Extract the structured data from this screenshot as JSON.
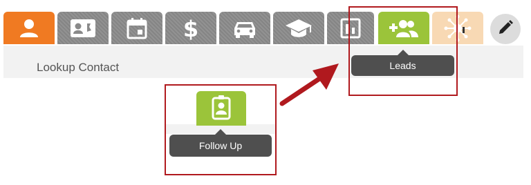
{
  "toolbar": {
    "tabs": [
      {
        "name": "contacts",
        "icon": "person-icon",
        "color": "#f07a22"
      },
      {
        "name": "contact-card",
        "icon": "contact-card-icon",
        "color": "#8a8a8a"
      },
      {
        "name": "calendar",
        "icon": "calendar-icon",
        "color": "#8a8a8a"
      },
      {
        "name": "finance",
        "icon": "dollar-icon",
        "color": "#8a8a8a"
      },
      {
        "name": "vehicles",
        "icon": "car-icon",
        "color": "#8a8a8a"
      },
      {
        "name": "education",
        "icon": "graduation-cap-icon",
        "color": "#8a8a8a"
      },
      {
        "name": "reports",
        "icon": "bar-chart-icon",
        "color": "#8a8a8a"
      },
      {
        "name": "leads",
        "icon": "add-people-icon",
        "color": "#9bc43a"
      },
      {
        "name": "network",
        "icon": "network-burst-icon",
        "color": "#f8d9b4"
      }
    ],
    "edit_icon": "pencil-icon"
  },
  "subbar": {
    "label": "Lookup Contact"
  },
  "tooltips": {
    "leads": "Leads",
    "follow_up": "Follow Up"
  },
  "follow_up": {
    "icon": "badge-person-icon",
    "color": "#9bc43a"
  },
  "annotation": {
    "highlight_color": "#b0191e",
    "arrow_color": "#b0191e"
  }
}
